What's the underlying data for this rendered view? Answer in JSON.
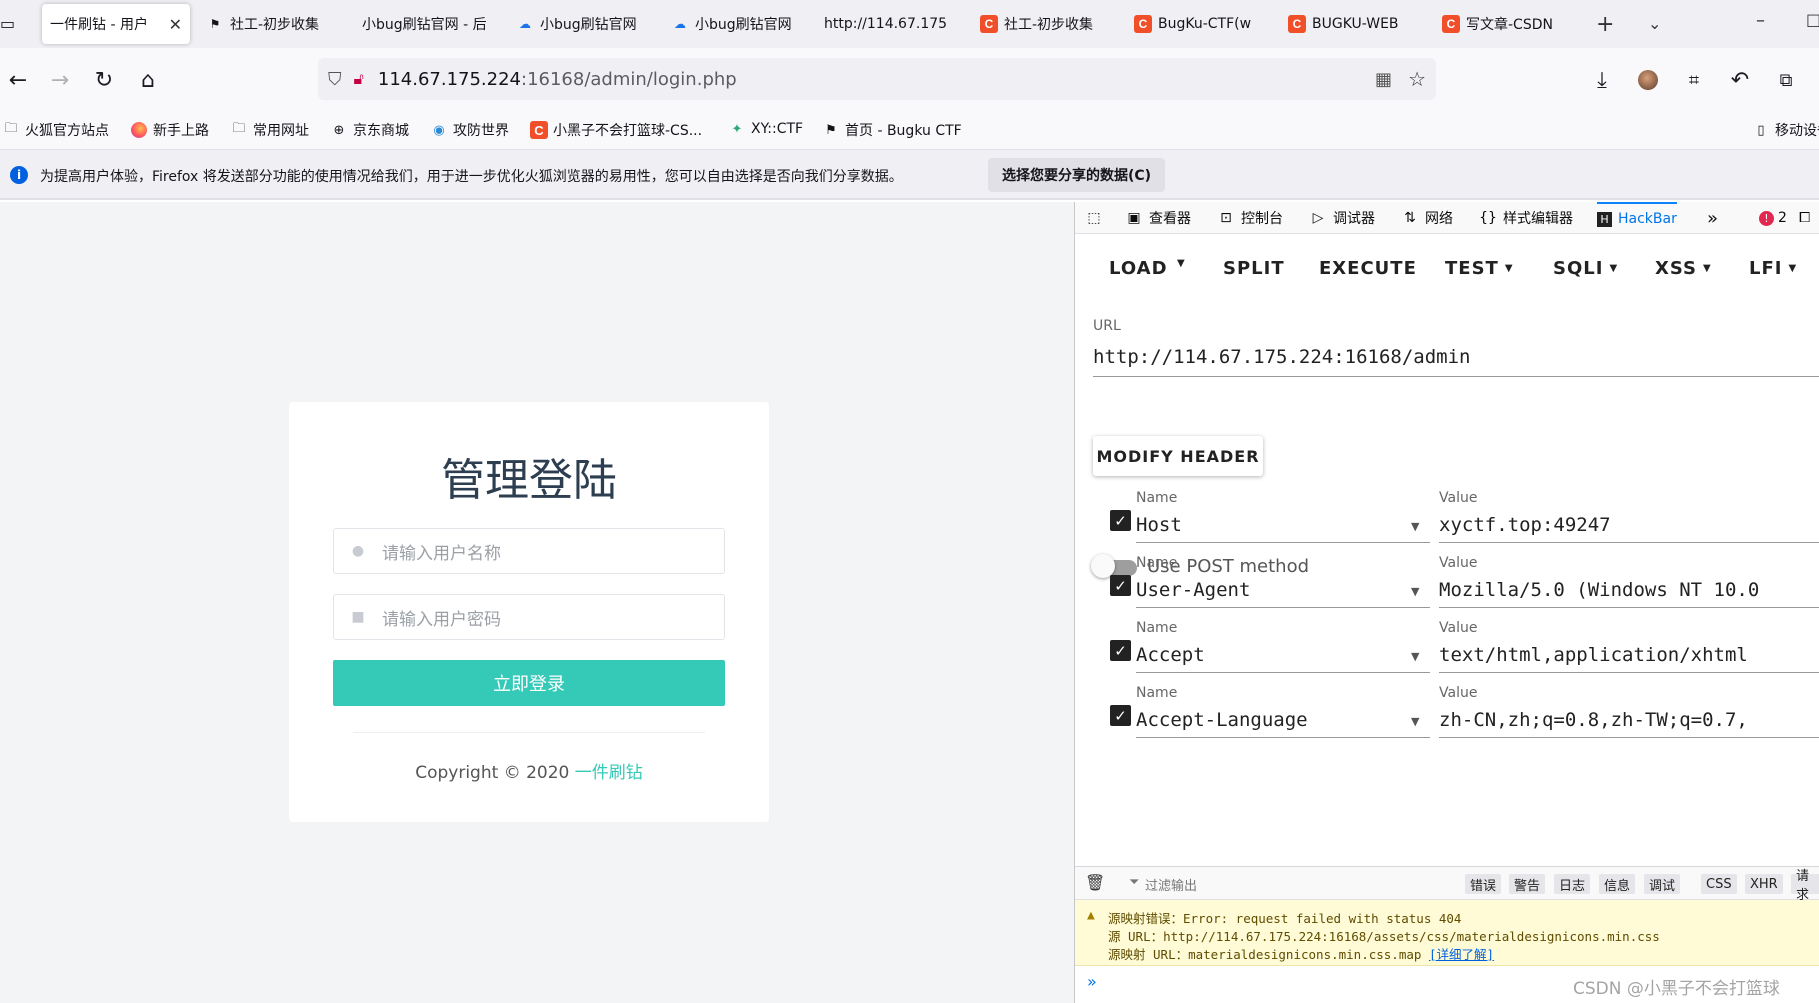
{
  "tabs": [
    {
      "label": "一件刷钻 - 用户",
      "icon": "none",
      "active": true
    },
    {
      "label": "社工-初步收集",
      "icon": "flag-icon"
    },
    {
      "label": "小bug刷钻官网 - 后",
      "icon": "none"
    },
    {
      "label": "小bug刷钻官网",
      "icon": "cloud-icon"
    },
    {
      "label": "小bug刷钻官网",
      "icon": "cloud-icon"
    },
    {
      "label": "http://114.67.175.",
      "icon": "none"
    },
    {
      "label": "社工-初步收集",
      "icon": "c-icon"
    },
    {
      "label": "BugKu-CTF(w",
      "icon": "c-icon"
    },
    {
      "label": "BUGKU-WEB",
      "icon": "c-icon"
    },
    {
      "label": "写文章-CSDN",
      "icon": "c-icon"
    }
  ],
  "url": {
    "host": "114.67.175.224",
    "path": ":16168/admin/login.php"
  },
  "bookmarks": [
    {
      "label": "火狐官方站点",
      "icon": "folder-icon"
    },
    {
      "label": "新手上路",
      "icon": "firefox-icon"
    },
    {
      "label": "常用网址",
      "icon": "folder-icon"
    },
    {
      "label": "京东商城",
      "icon": "globe-icon"
    },
    {
      "label": "攻防世界",
      "icon": "shield-icon"
    },
    {
      "label": "小黑子不会打篮球-CS...",
      "icon": "c-icon"
    },
    {
      "label": "XY::CTF",
      "icon": "bird-icon"
    },
    {
      "label": "首页 - Bugku CTF",
      "icon": "flag-icon"
    }
  ],
  "mobile_bookmarks": "移动设备",
  "notification": {
    "text": "为提高用户体验，Firefox 将发送部分功能的使用情况给我们，用于进一步优化火狐浏览器的易用性，您可以自由选择是否向我们分享数据。",
    "button": "选择您要分享的数据(C)"
  },
  "login": {
    "title": "管理登陆",
    "username_placeholder": "请输入用户名称",
    "password_placeholder": "请输入用户密码",
    "submit": "立即登录",
    "copyright": "Copyright © 2020 ",
    "brand": "一件刷钻",
    "accent": "#35c9b7"
  },
  "devtools": {
    "tabs": [
      "查看器",
      "控制台",
      "调试器",
      "网络",
      "样式编辑器",
      "HackBar"
    ],
    "error_count": "2",
    "hackbar": {
      "menu": [
        "LOAD",
        "SPLIT",
        "EXECUTE",
        "TEST",
        "SQLI",
        "XSS",
        "LFI"
      ],
      "url_label": "URL",
      "url_value": "http://114.67.175.224:16168/admin",
      "post_label": "Use POST method",
      "modify_header": "MODIFY HEADER",
      "name_label": "Name",
      "value_label": "Value",
      "headers": [
        {
          "name": "Host",
          "value": "xyctf.top:49247"
        },
        {
          "name": "User-Agent",
          "value": "Mozilla/5.0 (Windows NT 10.0"
        },
        {
          "name": "Accept",
          "value": "text/html,application/xhtml"
        },
        {
          "name": "Accept-Language",
          "value": "zh-CN,zh;q=0.8,zh-TW;q=0.7,"
        }
      ]
    },
    "console": {
      "filter_placeholder": "过滤输出",
      "filters": [
        "错误",
        "警告",
        "日志",
        "信息",
        "调试",
        "CSS",
        "XHR",
        "请求"
      ],
      "warn_line1": "源映射错误：Error: request failed with status 404",
      "warn_line2": "源 URL：http://114.67.175.224:16168/assets/css/materialdesignicons.min.css",
      "warn_line3": "源映射 URL：materialdesignicons.min.css.map ",
      "warn_link": "[详细了解]"
    }
  },
  "watermark": "CSDN @小黑子不会打篮球"
}
